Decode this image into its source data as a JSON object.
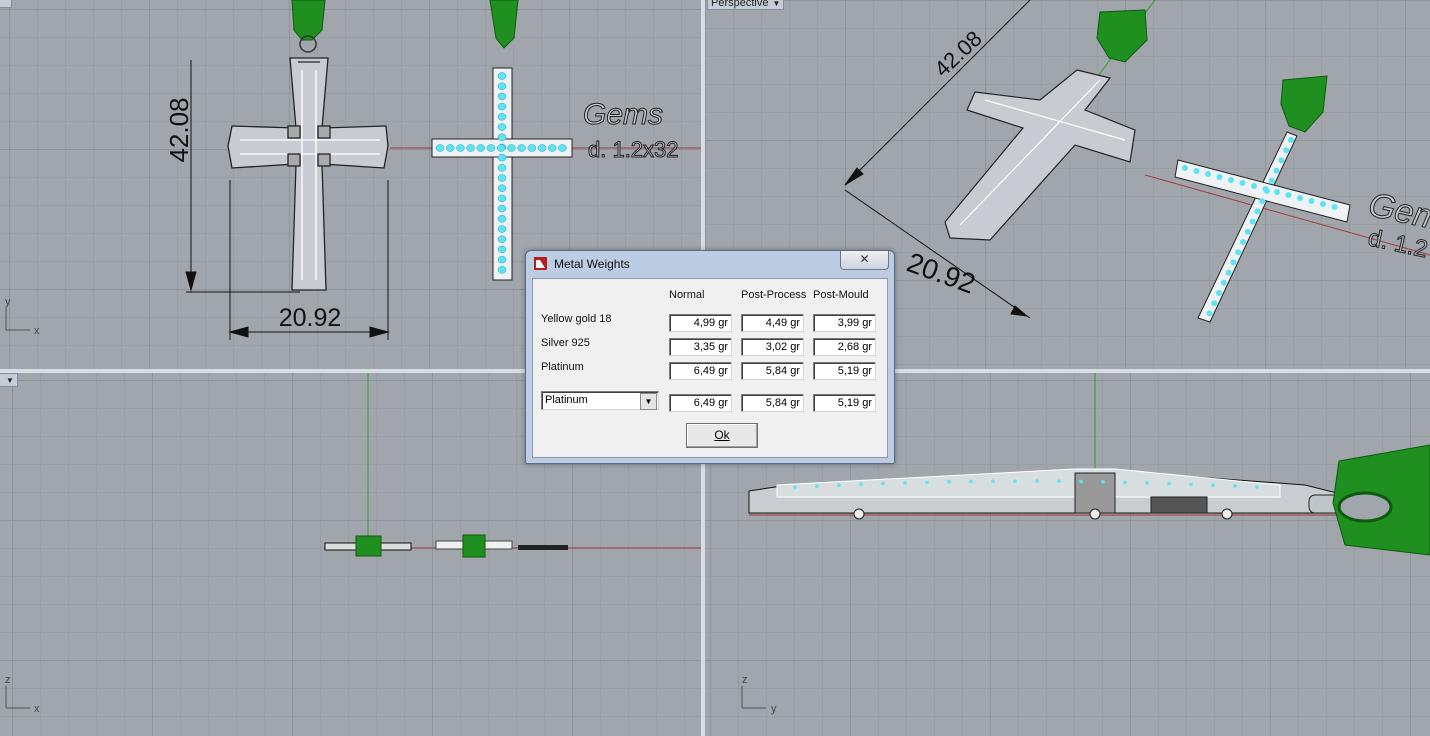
{
  "viewports": {
    "top": {
      "dim_height": "42.08",
      "dim_width": "20.92",
      "gems_title": "Gems",
      "gems_sub": "d. 1.2x32",
      "axis_v": "y",
      "axis_h": "x"
    },
    "perspective": {
      "label": "Perspective",
      "dim_height": "42.08",
      "dim_width": "20.92",
      "gems_title": "Gems",
      "gems_sub": "d. 1.2"
    },
    "front": {
      "axis_v": "z",
      "axis_h": "x"
    },
    "right": {
      "axis_v": "z",
      "axis_h": "y"
    }
  },
  "dialog": {
    "title": "Metal Weights",
    "close": "✕",
    "columns": [
      "Normal",
      "Post-Process",
      "Post-Mould"
    ],
    "rows": [
      {
        "label": "Yellow gold 18",
        "values": [
          "4,99 gr",
          "4,49 gr",
          "3,99 gr"
        ]
      },
      {
        "label": "Silver 925",
        "values": [
          "3,35 gr",
          "3,02 gr",
          "2,68 gr"
        ]
      },
      {
        "label": "Platinum",
        "values": [
          "6,49 gr",
          "5,84 gr",
          "5,19 gr"
        ]
      }
    ],
    "selected_metal": "Platinum",
    "selected_values": [
      "6,49 gr",
      "5,84 gr",
      "5,19 gr"
    ],
    "ok": "Ok"
  },
  "colors": {
    "gem": "#5fe3f3",
    "bail": "#1f8f1f",
    "x_axis": "#a33a3a",
    "y_axis": "#2f9a2f"
  }
}
